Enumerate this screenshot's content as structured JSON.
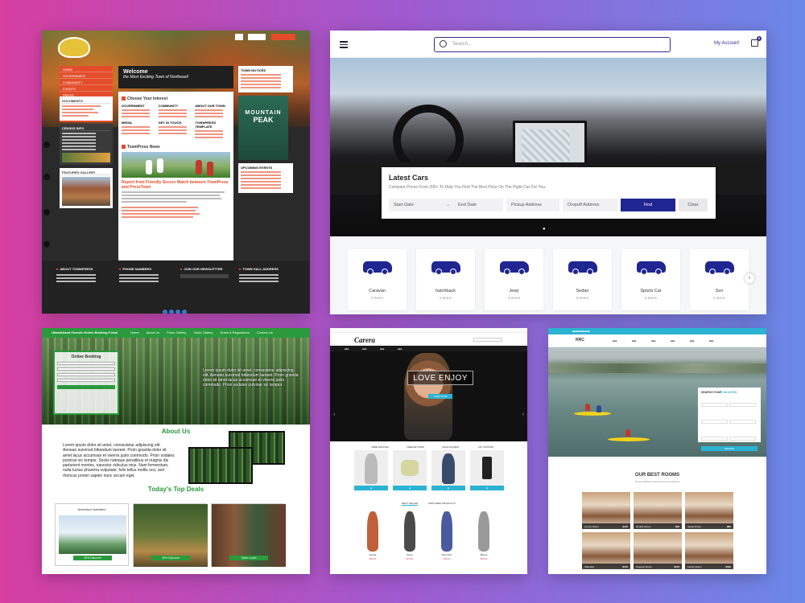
{
  "townpress": {
    "welcome_title": "Welcome",
    "welcome_sub": "the Most Exciting Town of Northeast!",
    "nav_items": [
      "HOME",
      "GOVERNMENT",
      "COMMUNITY",
      "EVENTS",
      "PRESS"
    ],
    "documents_heading": "DOCUMENTS",
    "census_heading": "CENSUS INFO",
    "gallery_heading": "FEATURED GALLERY",
    "choose_interest": "Choose Your Interest",
    "interest_columns": [
      "GOVERNMENT",
      "COMMUNITY",
      "ABOUT OUR TOWN",
      "MEDIA",
      "GET IN TOUCH",
      "TOWNPRESS TEMPLATE"
    ],
    "news_heading": "TownPress News",
    "news_title": "Report from Friendly Soccer Match between TownPress and PressTown",
    "town_notices": "TOWN NOTICES",
    "upcoming_events": "UPCOMING EVENTS",
    "ad_mountain": "MOUNTAIN",
    "ad_peak": "PEAK",
    "footer_cols": [
      "ABOUT TOWNPRESS",
      "PHONE NUMBERS",
      "JOIN OUR NEWSLETTER",
      "TOWN HALL ADDRESS"
    ]
  },
  "cars": {
    "search_placeholder": "Search...",
    "my_account": "My Account",
    "cart_count": "0",
    "panel_title": "Latest Cars",
    "panel_sub": "Compare Prices From 200+ To Help You Find The Best Price On The Right Car For You.",
    "start_date": "Start Date",
    "end_date": "End Date",
    "pickup": "Pickup Address",
    "dropoff": "Dropoff Address",
    "find": "Find",
    "clear": "Clear",
    "categories": [
      {
        "name": "Caravan",
        "count": "5 Items"
      },
      {
        "name": "hatchback",
        "count": "5 Items"
      },
      {
        "name": "Jeep",
        "count": "5 Items"
      },
      {
        "name": "Sedan",
        "count": "5 Items"
      },
      {
        "name": "Sports Car",
        "count": "5 Items"
      },
      {
        "name": "Suv",
        "count": "5 Items"
      }
    ],
    "brand_color": "#1f2591"
  },
  "forest": {
    "brand": "Uttarakhand Forests Online Booking Portal",
    "nav": [
      "Home",
      "About Us",
      "Photo Gallery",
      "Video Gallery",
      "Rules & Regulations",
      "Contact Us"
    ],
    "booking_title": "Online Booking",
    "about_title": "About Us",
    "about_text": "Lorem ipsum dolor sit amet, consectetur adipiscing elit. Aenean euismod bibendum laoreet. Proin gravida dolor sit amet lacus accumsan et viverra justo commodo. Proin sodales pulvinar sic tempor. Sociis natoque penatibus et magnis dis parturient montes, nascetur ridiculus mus. Nam fermentum, nulla luctus pharetra vulputate, felis tellus mollis orci, sed rhoncus pronin sapien nunc accum eget.",
    "hero_text": "Lorem ipsum dolor sit amet, consectetur adipiscing elit. Aenean euismod bibendum laoreet. Proin gravida dolor sit amet lacus accumsan et viverra justo commodo. Proin sodales pulvinar sic tempor.",
    "deals_title": "Today's Top Deals",
    "deals": [
      {
        "title": "Adventure Activities",
        "button": "30% Discount"
      },
      {
        "title": "",
        "button": "30% Discount"
      },
      {
        "title": "",
        "button": "Table Lunch"
      }
    ],
    "accent": "#2a9a3c"
  },
  "carera": {
    "logo": "Carera",
    "hero_text": "LOVE ENJOY",
    "shop_now": "SHOP NOW",
    "features": [
      "FREE SHIPPING",
      "FREE RETURNS",
      "SAFE PAYMENT",
      "24/7 SUPPORT"
    ],
    "tabs": [
      "BEST SELLER",
      "FEATURED PRODUCTS"
    ],
    "products": [
      {
        "name": "Hoodie",
        "price": "$69.00"
      },
      {
        "name": "Dress",
        "price": "$79.00"
      },
      {
        "name": "Polo Shirt",
        "price": "$49.00"
      },
      {
        "name": "Blouse",
        "price": "$59.00"
      }
    ],
    "accent": "#2ab3d3"
  },
  "hotel": {
    "logo": "RRC",
    "search_title": "SEARCH YOUR",
    "search_title_accent": "VACATION",
    "search_button": "SEARCH",
    "rooms_title": "OUR BEST ROOMS",
    "rooms_sub": "Find and Book Amazing Accommodations",
    "rooms": [
      {
        "name": "Luxury Room",
        "price": "$120"
      },
      {
        "name": "Double Room",
        "price": "$90"
      },
      {
        "name": "Single Room",
        "price": "$80"
      },
      {
        "name": "Standard",
        "price": "$100"
      },
      {
        "name": "Superior Room",
        "price": "$150"
      },
      {
        "name": "Family Room",
        "price": "$180"
      }
    ],
    "accent": "#2ab3d3"
  }
}
